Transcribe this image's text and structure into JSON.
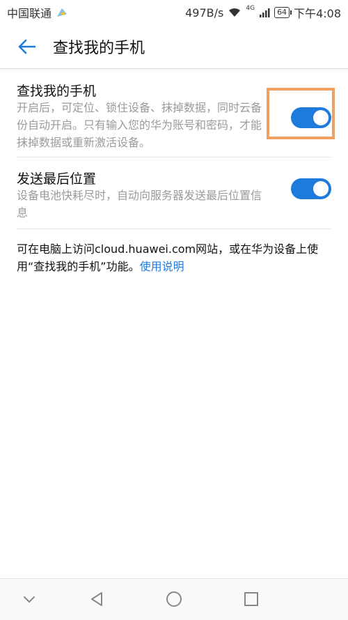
{
  "status_bar": {
    "carrier": "中国联通",
    "speed": "497B/s",
    "network": "4G",
    "battery": "64",
    "time": "下午4:08"
  },
  "header": {
    "title": "查找我的手机"
  },
  "settings": [
    {
      "title": "查找我的手机",
      "description": "开启后，可定位、锁住设备、抹掉数据，同时云备份自动开启。只有输入您的华为账号和密码，才能抹掉数据或重新激活设备。",
      "enabled": true
    },
    {
      "title": "发送最后位置",
      "description": "设备电池快耗尽时，自动向服务器发送最后位置信息",
      "enabled": true
    }
  ],
  "footer": {
    "text": "可在电脑上访问cloud.huawei.com网站，或在华为设备上使用“查找我的手机”功能。",
    "link": "使用说明"
  },
  "colors": {
    "accent": "#1e7bdc",
    "highlight": "#f0a060"
  },
  "icons": {
    "back": "back-arrow-icon",
    "nav_down": "chevron-down-icon",
    "nav_back": "triangle-back-icon",
    "nav_home": "circle-home-icon",
    "nav_recent": "square-recent-icon"
  }
}
